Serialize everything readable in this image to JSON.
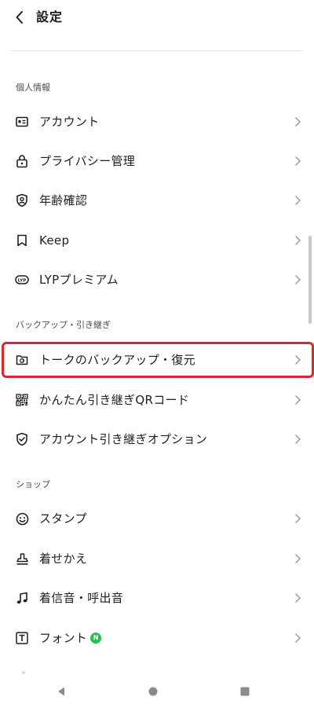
{
  "header": {
    "title": "設定"
  },
  "sections": [
    {
      "title": "個人情報",
      "items": [
        {
          "label": "アカウント",
          "icon": "id-card-icon"
        },
        {
          "label": "プライバシー管理",
          "icon": "lock-icon"
        },
        {
          "label": "年齢確認",
          "icon": "age-shield-icon"
        },
        {
          "label": "Keep",
          "icon": "bookmark-icon"
        },
        {
          "label": "LYPプレミアム",
          "icon": "lyp-badge-icon"
        }
      ]
    },
    {
      "title": "バックアップ・引き継ぎ",
      "items": [
        {
          "label": "トークのバックアップ・復元",
          "icon": "backup-icon",
          "highlighted": true
        },
        {
          "label": "かんたん引き継ぎQRコード",
          "icon": "qr-code-icon"
        },
        {
          "label": "アカウント引き継ぎオプション",
          "icon": "shield-check-icon"
        }
      ]
    },
    {
      "title": "ショップ",
      "items": [
        {
          "label": "スタンプ",
          "icon": "smiley-icon"
        },
        {
          "label": "着せかえ",
          "icon": "theme-stamp-icon"
        },
        {
          "label": "着信音・呼出音",
          "icon": "music-note-icon"
        },
        {
          "label": "フォント",
          "icon": "font-icon",
          "badge": "N"
        }
      ]
    }
  ],
  "colors": {
    "highlight": "#e0252b",
    "new_badge": "#25c04d"
  },
  "navbar": {
    "icons": [
      "nav-back-icon",
      "nav-home-icon",
      "nav-recents-icon"
    ]
  }
}
